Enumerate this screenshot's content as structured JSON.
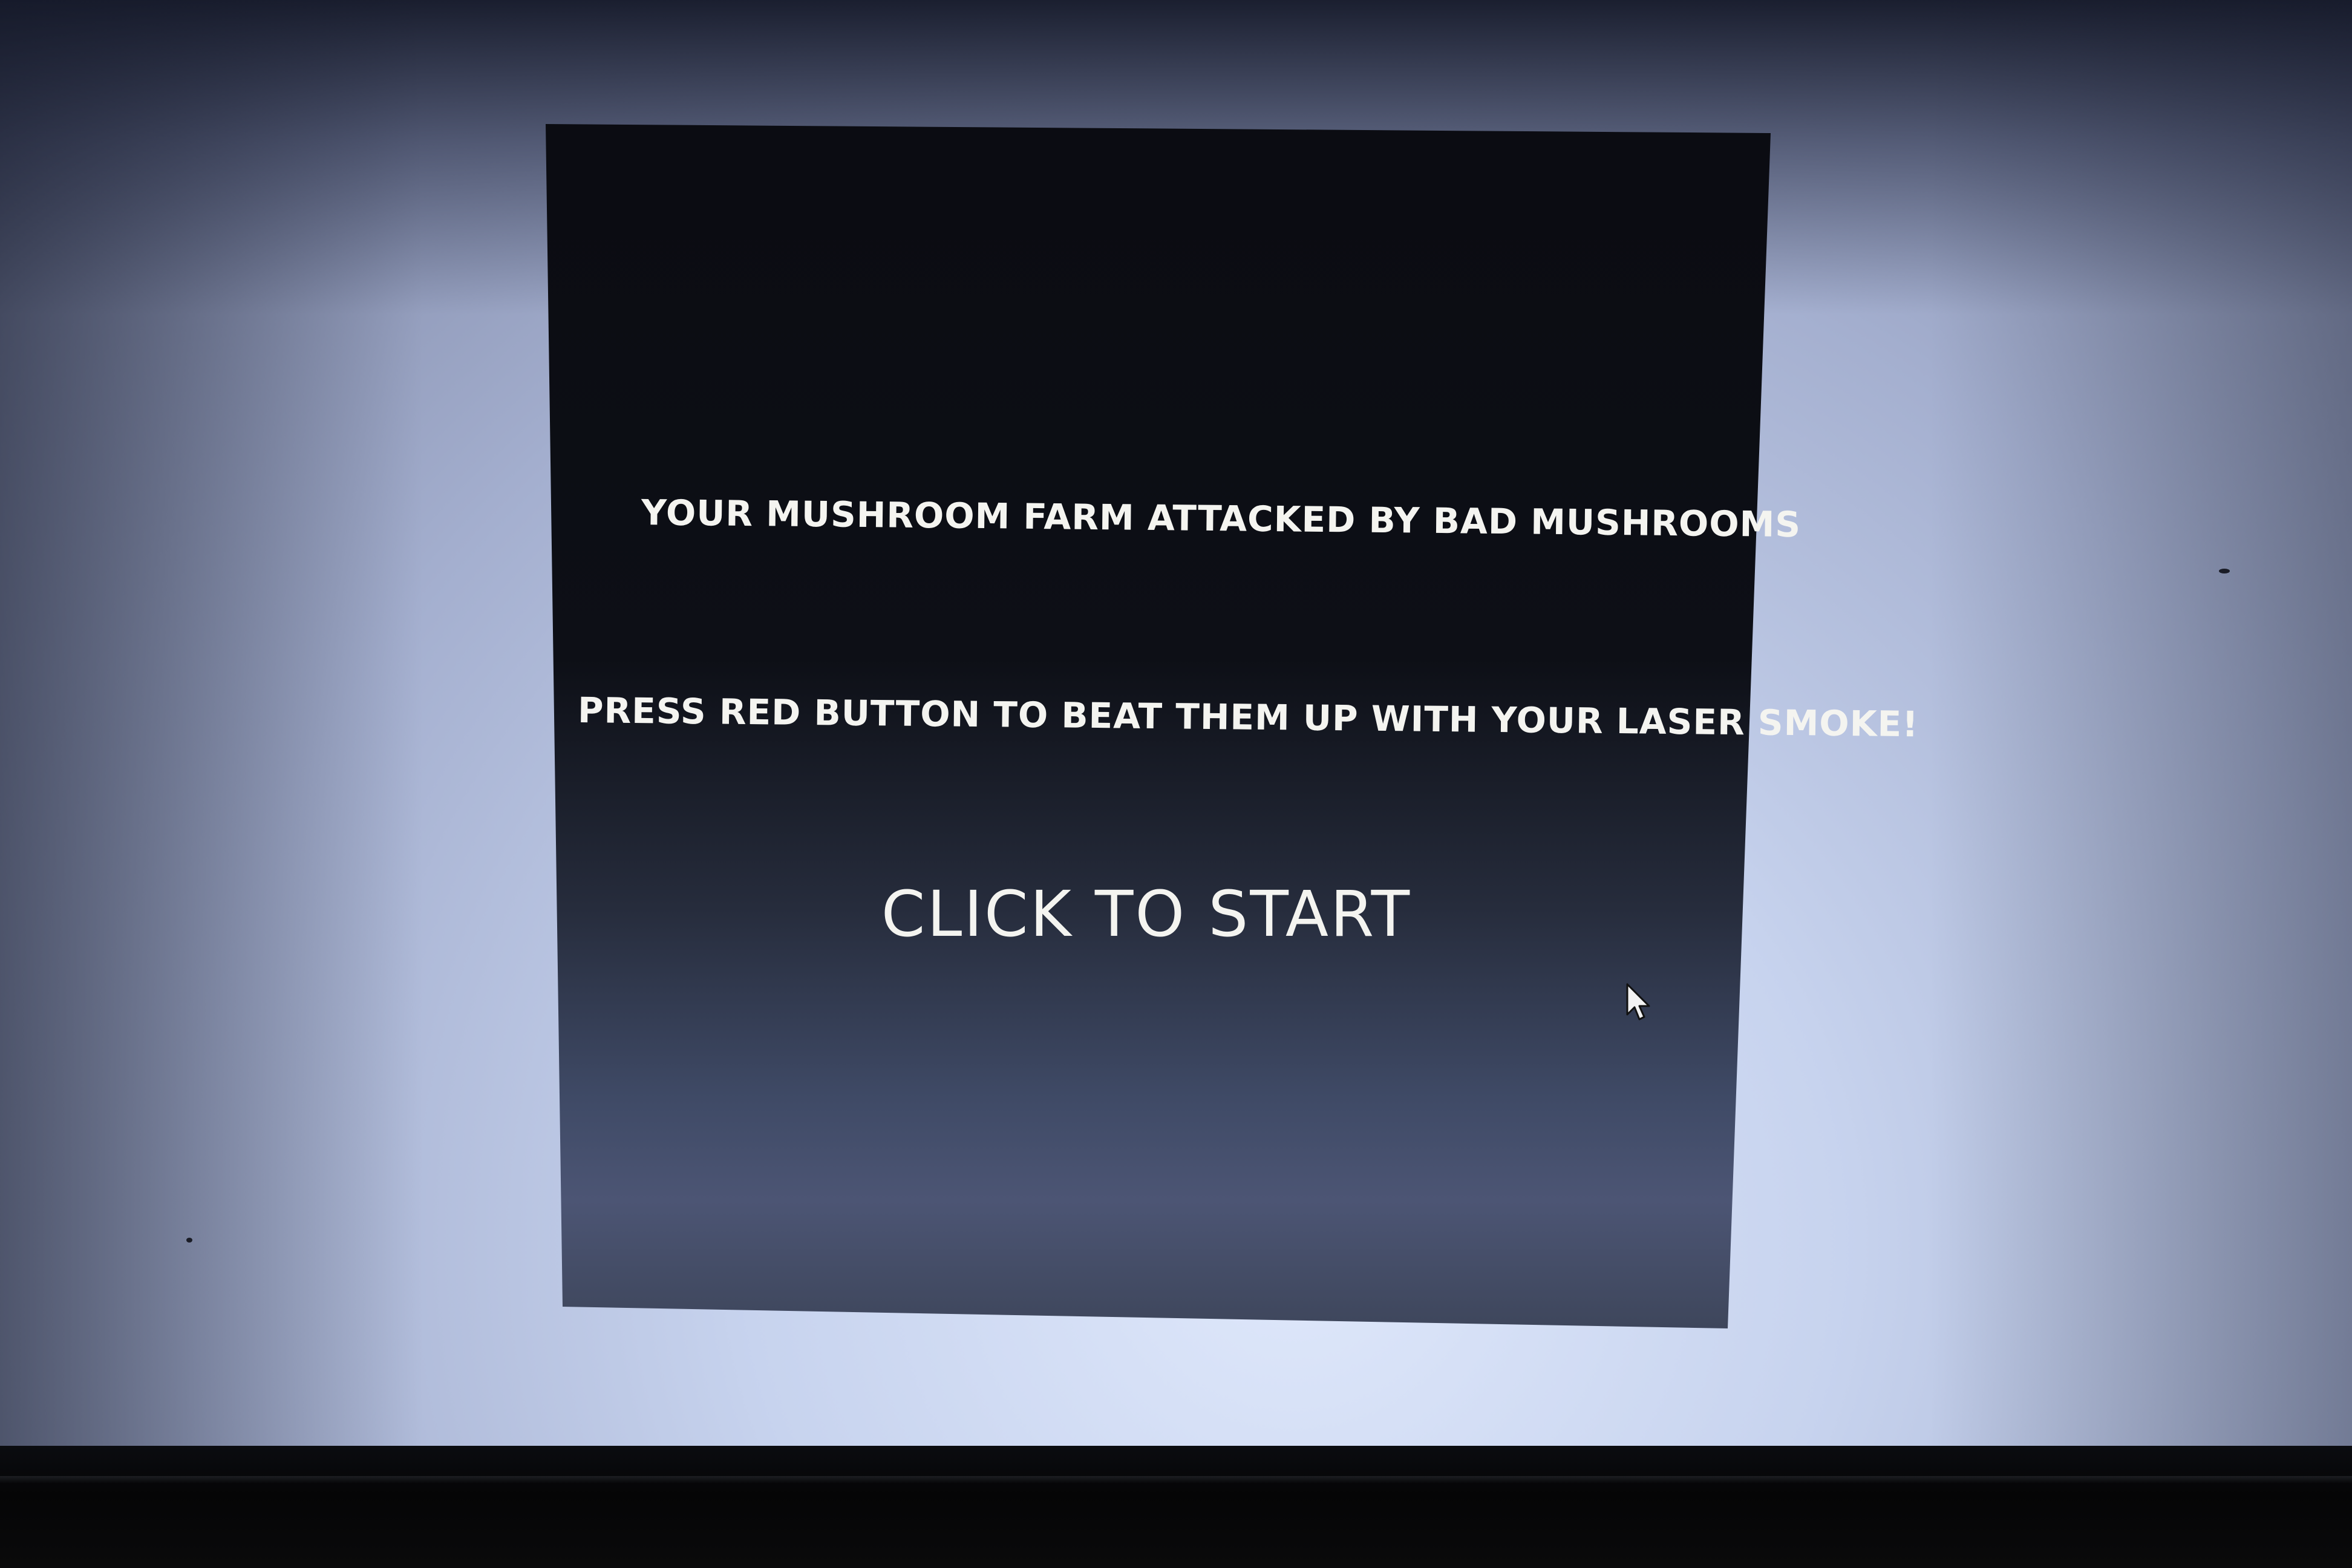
{
  "game": {
    "story_line_1": "YOUR MUSHROOM FARM ATTACKED BY BAD MUSHROOMS",
    "story_line_2": "PRESS RED BUTTON TO BEAT THEM UP WITH YOUR LASER SMOKE!",
    "start_prompt": "CLICK TO START"
  },
  "colors": {
    "canvas_top": "#0b0c12",
    "canvas_bottom": "#4c5574",
    "text": "#f4f4f0",
    "screen_glow": "#dfe8fb"
  },
  "icons": {
    "pointer": "mouse-pointer-icon"
  }
}
